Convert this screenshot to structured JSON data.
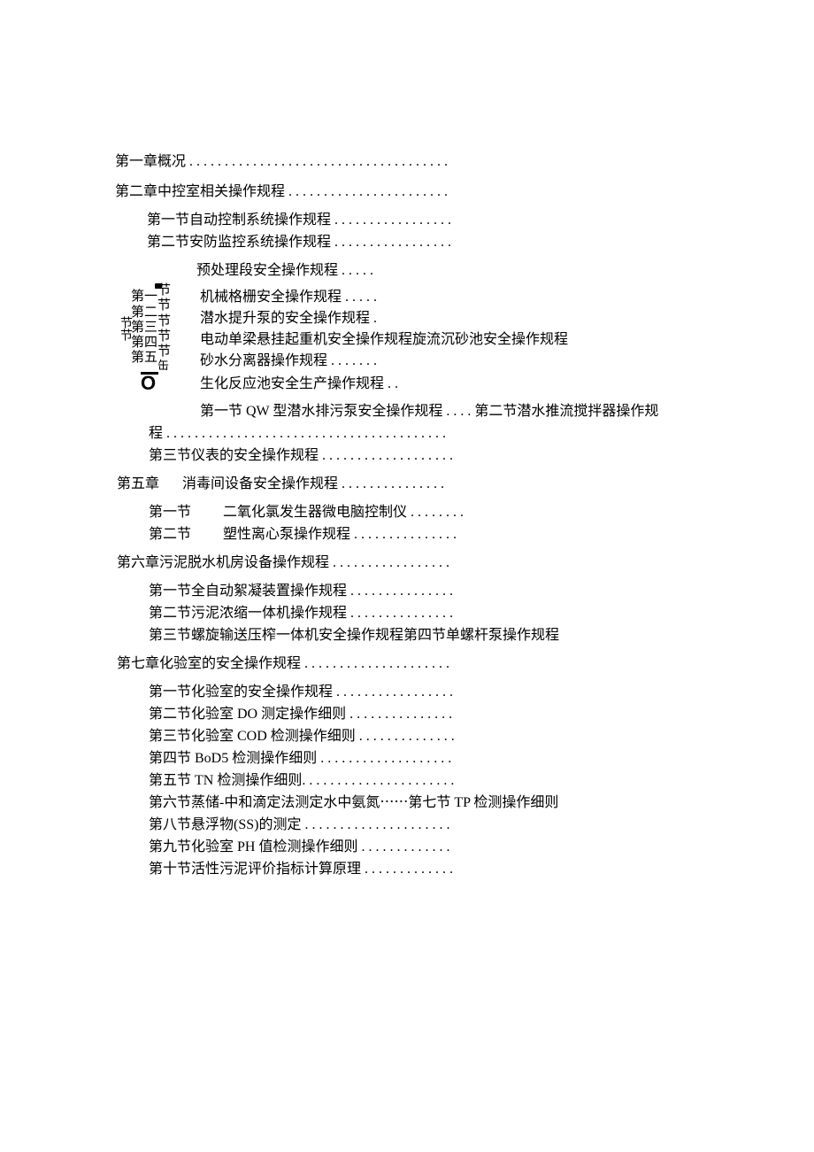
{
  "ch1": "第一章概况 . . . . . . . . . . . . . . . . . . . . . . . . . . . . . . . . . . . . .",
  "ch2": "第二章中控室相关操作规程 . . . . . . . . . . . . . . . . . . . . . . .",
  "ch2s1": "第一节自动控制系统操作规程 . . . . . . . . . . . . . . . . .",
  "ch2s2": "第二节安防监控系统操作规程 . . . . . . . . . . . . . . . . .",
  "pretreat": "预处理段安全操作规程 . . . . .",
  "vb_left": "节节",
  "vb_c1": [
    "第",
    "第",
    "第",
    "第",
    "第"
  ],
  "vb_c2": [
    "一",
    "二",
    "三",
    "四",
    "五"
  ],
  "vb_c3": [
    "节",
    "节",
    "节",
    "节",
    "节"
  ],
  "vb_last": "缶",
  "ch3_1": "机械格栅安全操作规程 . . . . .",
  "ch3_2": "潜水提升泵的安全操作规程 .",
  "ch3_3": "电动单梁悬挂起重机安全操作规程旋流沉砂池安全操作规程",
  "ch3_4": "砂水分离器操作规程 . . . . . . .",
  "ch4_title": "生化反应池安全生产操作规程 . .",
  "ch4_s1s2": "第一节 QW 型潜水排污泵安全操作规程 . . . . 第二节潜水推流搅拌器操作规",
  "ch4_cont": "程 . . . . . . . . . . . . . . . . . . . . . . . . . . . . . . . . . . . . . . . .",
  "ch4_s3": "第三节仪表的安全操作规程 . . . . . . . . . . . . . . . . . . .",
  "ch5": "第五章",
  "ch5_title": "消毒间设备安全操作规程 . . . . . . . . . . . . . . .",
  "ch5_s1_label": "第一节",
  "ch5_s1": "二氧化氯发生器微电脑控制仪 . . . . . . . .",
  "ch5_s2_label": "第二节",
  "ch5_s2": "塑性离心泵操作规程 . . . . . . . . . . . . . . .",
  "ch6": "第六章污泥脱水机房设备操作规程 . . . . . . . . . . . . . . . . .",
  "ch6_s1": "第一节全自动絮凝装置操作规程 . . . . . . . . . . . . . . .",
  "ch6_s2": "第二节污泥浓缩一体机操作规程 . . . . . . . . . . . . . . .",
  "ch6_s3": "第三节螺旋输送压榨一体机安全操作规程第四节单螺杆泵操作规程",
  "ch7": "第七章化验室的安全操作规程 . . . . . . . . . . . . . . . . . . . . .",
  "ch7_s1": "第一节化验室的安全操作规程 . . . . . . . . . . . . . . . . .",
  "ch7_s2": "第二节化验室 DO 测定操作细则 . . . . . . . . . . . . . . .",
  "ch7_s3": "第三节化验室 COD 检测操作细则 . . . . . . . . . . . . . .",
  "ch7_s4": "第四节 BoD5 检测操作细则 . . . . . . . . . . . . . . . . . . .",
  "ch7_s5": "第五节 TN 检测操作细则. . . . . . . . . . . . . . . . . . . . . .",
  "ch7_s6": "第六节蒸储-中和滴定法测定水中氨氮⋯⋯第七节 TP 检测操作细则",
  "ch7_s8": "第八节悬浮物(SS)的测定 . . . . . . . . . . . . . . . . . . . . .",
  "ch7_s9": "第九节化验室 PH 值检测操作细则 . . . . . . . . . . . . .",
  "ch7_s10": "第十节活性污泥评价指标计算原理 . . . . . . . . . . . . .",
  "zero": "O"
}
